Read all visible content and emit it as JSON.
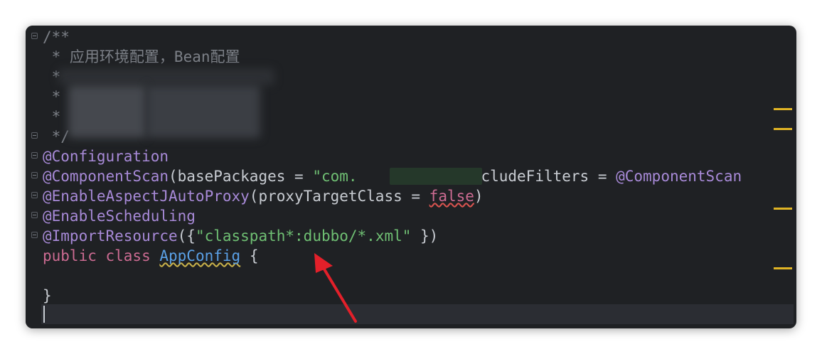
{
  "editor": {
    "lines": {
      "l1": "/**",
      "l2": " * 应用环境配置，Bean配置",
      "l3": " *",
      "l4": " *",
      "l5": " *",
      "l6": " */",
      "l7": "@Configuration",
      "l8a": "@ComponentScan",
      "l8b": "(basePackages = ",
      "l8c": "\"com.",
      "l8d": " excludeFilters = ",
      "l8e": "@ComponentScan",
      "l9a": "@EnableAspectJAutoProxy",
      "l9b": "(proxyTargetClass = ",
      "l9c": "false",
      "l9d": ")",
      "l10": "@EnableScheduling",
      "l11a": "@ImportResource",
      "l11b": "({",
      "l11c": "\"classpath*:dubbo/*.xml\"",
      "l11d": " })",
      "l12a": "public class ",
      "l12b": "AppConfig",
      "l12c": " {",
      "l14": "}"
    }
  },
  "colors": {
    "background": "#1f2124",
    "comment": "#7c8087",
    "annotation": "#a88ad8",
    "string": "#6fbf73",
    "keyword": "#cc6b92",
    "class_name": "#5aa0e6",
    "arrow": "#e3202a",
    "marker": "#e0b425"
  }
}
